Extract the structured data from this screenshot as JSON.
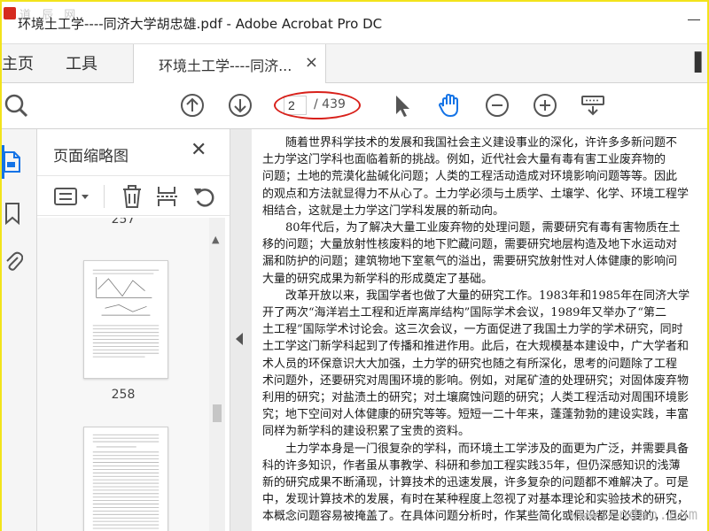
{
  "window": {
    "title": "环境土工学----同济大学胡忠雄.pdf - Adobe Acrobat Pro DC",
    "watermark_top": "道 辰 网",
    "brand_color": "#d62b1f"
  },
  "tabs": {
    "home": "主页",
    "tools": "工具",
    "document": "环境土工学----同济...",
    "close_glyph": "×",
    "extra_glyph": "▌"
  },
  "toolbar": {
    "icons": [
      "search-icon",
      "page-up-icon",
      "page-down-icon",
      "select-cursor-icon",
      "hand-tool-icon",
      "zoom-out-icon",
      "zoom-in-icon",
      "keyboard-tool-icon"
    ],
    "current_page": "2",
    "page_total": "/ 439",
    "highlight_color": "#d8201a",
    "active_tool_color": "#1473e6"
  },
  "left_rail": {
    "icons": [
      "page-thumbnails-icon",
      "bookmarks-icon",
      "attachments-icon"
    ]
  },
  "panel": {
    "title": "页面缩略图",
    "close_glyph": "✕",
    "tools": [
      "options-menu-icon",
      "delete-icon",
      "insert-page-icon",
      "rotate-icon"
    ],
    "thumbnails": [
      {
        "label": "257"
      },
      {
        "label": "258"
      }
    ]
  },
  "document": {
    "lines": [
      "　　随着世界科学技术的发展和我国社会主义建设事业的深化，许许多多新问题不",
      "土力学这门学科也面临着新的挑战。例如，近代社会大量有毒有害工业废弃物的",
      "问题；土地的荒漠化盐碱化问题；人类的工程活动造成对环境影响问题等等。因此",
      "的观点和方法就显得力不从心了。土力学必须与土质学、土壤学、化学、环境工程学",
      "相结合，这就是土力学这门学科发展的新动向。",
      "　　80年代后，为了解决大量工业废弃物的处理问题，需要研究有毒有害物质在土",
      "移的问题；大量放射性核废料的地下贮藏问题，需要研究地层构造及地下水运动对",
      "漏和防护的问题；建筑物地下室氡气的溢出，需要研究放射性对人体健康的影响问",
      "大量的研究成果为新学科的形成奠定了基础。",
      "　　改革开放以来，我国学者也做了大量的研究工作。1983年和1985年在同济大学",
      "开了两次“海洋岩土工程和近岸离岸结构”国际学术会议，1989年又举办了“第二",
      "土工程”国际学术讨论会。这三次会议，一方面促进了我国土力学的学术研究，同时",
      "土工学这门新学科起到了传播和推进作用。此后，在大规模基本建设中，广大学者和",
      "术人员的环保意识大大加强，土力学的研究也随之有所深化，思考的问题除了工程",
      "术问题外，还要研究对周围环境的影响。例如，对尾矿渣的处理研究；对固体废弃物",
      "利用的研究；对盐渍土的研究；对土壤腐蚀问题的研究；人类工程活动对周围环境影",
      "究；地下空间对人体健康的研究等等。短短一二十年来，蓬蓬勃勃的建设实践，丰富",
      "同样为新学科的建设积累了宝贵的资料。",
      "　　土力学本身是一门很复杂的学科，而环境土工学涉及的面更为广泛，并需要具备",
      "科的许多知识，作者虽从事教学、科研和参加工程实践35年，但仍深感知识的浅薄",
      "新的研究成果不断涌现，计算技术的迅速发展，许多复杂的问题都不难解决了。可是",
      "中，发现计算技术的发展，有时在某种程度上忽视了对基本理论和实验技术的研究，",
      "本概念问题容易被掩盖了。在具体问题分析时，作某些简化或假设都是必要的，但必"
    ]
  },
  "watermark_bottom": "www.cndao.com"
}
